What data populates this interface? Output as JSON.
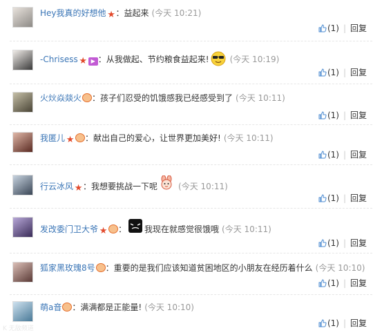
{
  "actions": {
    "like_count": "(1)",
    "reply_label": "回复"
  },
  "comments": [
    {
      "username": "Hey我真的好想他",
      "badges": [
        "star"
      ],
      "text": "益起来",
      "time": "(今天 10:21)",
      "avatar_color": "#8d8a86"
    },
    {
      "username": "-Chrisess",
      "badges": [
        "star",
        "vip"
      ],
      "text": "从我做起、节约粮食益起来!",
      "emoticon": "sunglasses-face",
      "time": "(今天 10:19)",
      "avatar_color": "#6b6b6b"
    },
    {
      "username": "火炏焱燚火",
      "badges": [
        "level"
      ],
      "text": "孩子们忍受的饥饿感我已经感受到了",
      "time": "(今天 10:11)",
      "avatar_color": "#8c8574"
    },
    {
      "username": "我匿儿",
      "badges": [
        "star",
        "level"
      ],
      "text": "献出自己的爱心，让世界更加美好!",
      "time": "(今天 10:11)",
      "avatar_color": "#a85c4a"
    },
    {
      "username": "行云冰风",
      "badges": [
        "star"
      ],
      "text": "我想要挑战一下呢",
      "emoticon": "rabbit-face",
      "time": "(今天 10:11)",
      "avatar_color": "#7c8a99"
    },
    {
      "username": "发改委门卫大爷",
      "badges": [
        "star",
        "level"
      ],
      "text": "我现在就感觉很饿哦",
      "emoticon": "black-cat-face",
      "time": "(今天 10:11)",
      "avatar_color": "#6a5c8c"
    },
    {
      "username": "狐家黑玫瑰8号",
      "badges": [
        "level"
      ],
      "text": "重要的是我们应该知道贫困地区的小朋友在经历着什么",
      "time": "(今天 10:10)",
      "avatar_color": "#8a6a66"
    },
    {
      "username": "萌a音",
      "badges": [
        "level"
      ],
      "text": "满满都是正能量!",
      "time": "(今天 10:10)",
      "avatar_color": "#6b9ab8"
    }
  ],
  "watermark": "K 无敌频道"
}
